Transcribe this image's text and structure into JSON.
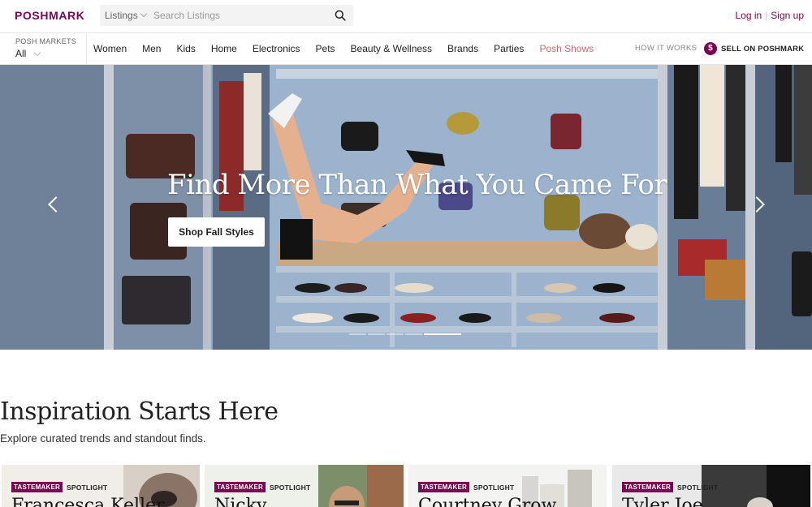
{
  "header": {
    "logo": "POSHMARK",
    "search": {
      "scope": "Listings",
      "placeholder": "Search Listings"
    },
    "login": "Log in",
    "signup": "Sign up"
  },
  "nav": {
    "posh_markets_label": "POSH MARKETS",
    "posh_markets_value": "All",
    "items": [
      "Women",
      "Men",
      "Kids",
      "Home",
      "Electronics",
      "Pets",
      "Beauty & Wellness",
      "Brands",
      "Parties",
      "Posh Shows"
    ],
    "how_it_works": "HOW IT WORKS",
    "sell": "SELL ON POSHMARK",
    "sell_icon_glyph": "$"
  },
  "hero": {
    "title": "Find More Than What You Came For",
    "cta": "Shop Fall Styles",
    "slide_count": 5,
    "active_slide": 5
  },
  "inspiration": {
    "title": "Inspiration Starts Here",
    "subtitle": "Explore curated trends and standout finds.",
    "cards": [
      {
        "tag": "TASTEMAKER",
        "label": "SPOTLIGHT",
        "name": "Francesca Keller"
      },
      {
        "tag": "TASTEMAKER",
        "label": "SPOTLIGHT",
        "name": "Nicky"
      },
      {
        "tag": "TASTEMAKER",
        "label": "SPOTLIGHT",
        "name": "Courtney Grow"
      },
      {
        "tag": "TASTEMAKER",
        "label": "SPOTLIGHT",
        "name": "Tyler Joe"
      }
    ]
  },
  "colors": {
    "brand": "#7f0353",
    "highlight": "#dd6270",
    "hero_wall": "#8aa3bf"
  },
  "icons": [
    "search-icon",
    "chevron-down-icon",
    "dollar-icon",
    "chevron-left-icon",
    "chevron-right-icon"
  ]
}
